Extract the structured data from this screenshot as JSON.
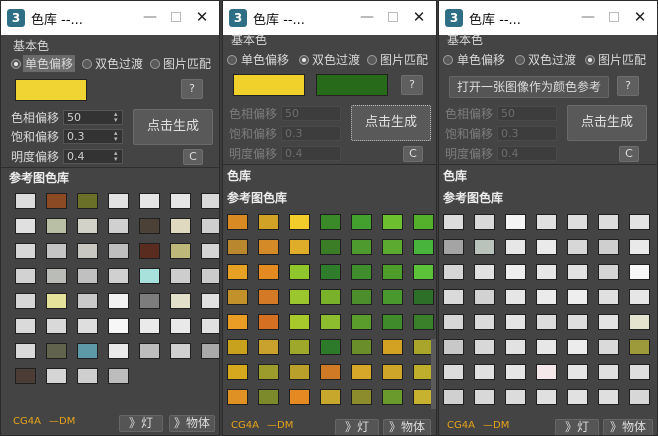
{
  "windows": [
    {
      "title": "色库 --...",
      "base_color_label": "基本色",
      "radios": [
        "单色偏移",
        "双色过渡",
        "图片匹配"
      ],
      "selected_radio": 0,
      "help_label": "?",
      "params": [
        {
          "label": "色相偏移",
          "value": "50"
        },
        {
          "label": "饱和偏移",
          "value": "0.3"
        },
        {
          "label": "明度偏移",
          "value": "0.4"
        }
      ],
      "params_enabled": true,
      "generate_label": "点击生成",
      "c_label": "C",
      "swatches": [
        "#f0d433"
      ],
      "ref_lib_label": "参考图色库",
      "footer": {
        "brand": "CG4A",
        "author": "—DM",
        "light_label": "》灯",
        "object_label": "》物体"
      },
      "ref_grid": [
        [
          "#dcdcdc",
          "#8c4a24",
          "#6b7028",
          "#e2e2e2",
          "#e4e4e4",
          "#e6e6e6",
          "#d9d9d9"
        ],
        [
          "#e0e0e0",
          "#b9bfa5",
          "#d2d2c8",
          "#d0d0d0",
          "#4b4136",
          "#ded9bf",
          "#cfcfcf"
        ],
        [
          "#d6d6d6",
          "#c4c4c4",
          "#c9c7c1",
          "#bfbfbf",
          "#5a2c20",
          "#bdb87a",
          "#d4d4d4"
        ],
        [
          "#d2d2d2",
          "#babcb8",
          "#c0c0c0",
          "#d0d0d0",
          "#a8e0dc",
          "#cdcdcd",
          "#cbcbcb"
        ],
        [
          "#d6d6d6",
          "#e5e29b",
          "#c8c8c8",
          "#f2f2f2",
          "#7d7d7d",
          "#e2e0c8",
          "#e0e0e0"
        ],
        [
          "#dadada",
          "#d9d9d9",
          "#dedede",
          "#f7f7f7",
          "#eaeaea",
          "#e9e9e9",
          "#e1e1e1"
        ],
        [
          "#d9d9d9",
          "#62634c",
          "#5d99a6",
          "#eaeaea",
          "#bdbdbd",
          "#cfcfcf",
          "#a9a9a9"
        ],
        [
          "#4b3c36",
          "#d5d5d5",
          "#cfcfcf",
          "#bdbdbd"
        ]
      ]
    },
    {
      "title": "色库 --...",
      "base_color_label": "基本色",
      "radios": [
        "单色偏移",
        "双色过渡",
        "图片匹配"
      ],
      "selected_radio": 1,
      "help_label": "?",
      "params": [
        {
          "label": "色相偏移",
          "value": "50"
        },
        {
          "label": "饱和偏移",
          "value": "0.3"
        },
        {
          "label": "明度偏移",
          "value": "0.4"
        }
      ],
      "params_enabled": false,
      "generate_label": "点击生成",
      "c_label": "C",
      "swatches": [
        "#f0d02a",
        "#276a1a"
      ],
      "color_lib_label": "色库",
      "ref_lib_label": "参考图色库",
      "footer": {
        "brand": "CG4A",
        "author": "—DM",
        "light_label": "》灯",
        "object_label": "》物体"
      },
      "color_grid": [
        [
          "#d98a22",
          "#d2a227",
          "#f1cc2a",
          "#3a8a2a",
          "#44a02e",
          "#6cbf2f",
          "#54b02a"
        ],
        [
          "#b8872e",
          "#d48a26",
          "#dfad2a",
          "#3b7c27",
          "#4e9a2e",
          "#5daa30",
          "#48b43c"
        ],
        [
          "#e6a024",
          "#e38a20",
          "#8fc62c",
          "#2f7d2c",
          "#3f8d2c",
          "#4e9d2b",
          "#5bc23a"
        ],
        [
          "#c2912a",
          "#d47a26",
          "#9cc62e",
          "#79b22a",
          "#4c8e2c",
          "#49982d",
          "#2d6f29"
        ],
        [
          "#e99d24",
          "#d56f22",
          "#a7c92c",
          "#8bbd2e",
          "#5a9d2d",
          "#3f8a2b",
          "#3a7f29"
        ]
      ],
      "ref_grid": [
        [
          "#c8a21c",
          "#c8a22c",
          "#9ea82a",
          "#2e7a2b",
          "#6a8f2a",
          "#d4a222",
          "#a9a42a"
        ],
        [
          "#d6a81e",
          "#9c9c2c",
          "#b9a02a",
          "#d07a25",
          "#d7a72a",
          "#cfa529",
          "#bfae2c"
        ],
        [
          "#e09123",
          "#7d8a2b",
          "#e58a22",
          "#c8a82c",
          "#8c8c2c",
          "#6a9a2c",
          "#c6b22e"
        ]
      ]
    },
    {
      "title": "色库 --...",
      "base_color_label": "基本色",
      "radios": [
        "单色偏移",
        "双色过渡",
        "图片匹配"
      ],
      "selected_radio": 2,
      "help_label": "?",
      "open_image_label": "打开一张图像作为颜色参考",
      "params": [
        {
          "label": "色相偏移",
          "value": "50"
        },
        {
          "label": "饱和偏移",
          "value": "0.3"
        },
        {
          "label": "明度偏移",
          "value": "0.4"
        }
      ],
      "params_enabled": false,
      "generate_label": "点击生成",
      "c_label": "C",
      "color_lib_label": "色库",
      "ref_lib_label": "参考图色库",
      "footer": {
        "brand": "CG4A",
        "author": "—DM",
        "light_label": "》灯",
        "object_label": "》物体"
      },
      "ref_grid": [
        [
          "#dcdcdc",
          "#d9d9d9",
          "#f4f4f4",
          "#e0e0e0",
          "#dedede",
          "#dcdcdc",
          "#e3e3e3"
        ],
        [
          "#a4a4a4",
          "#b9c2bb",
          "#e7e7e7",
          "#eaeaea",
          "#d7d7d7",
          "#cfcfcf",
          "#e9e9e9"
        ],
        [
          "#d5d5d5",
          "#e1e1e1",
          "#eeeeee",
          "#e7e7e7",
          "#e2e2e2",
          "#d3d3d3",
          "#f8f8f8"
        ],
        [
          "#dadada",
          "#d2d2d2",
          "#e6e6e6",
          "#ebebeb",
          "#eeeeee",
          "#e0e0e0",
          "#e6e6e6"
        ],
        [
          "#d6d6d6",
          "#dadada",
          "#e4e4e4",
          "#dcdcdc",
          "#dedede",
          "#e2e2e2",
          "#e3e3d0"
        ],
        [
          "#c8c8c8",
          "#d8d8d8",
          "#e2e2e2",
          "#e7e7e7",
          "#ececec",
          "#dadada",
          "#9c9a3a"
        ],
        [
          "#dbdbdb",
          "#e0e0e0",
          "#e5e5e5",
          "#f4e8ea",
          "#e5e5e5",
          "#e0e0e0",
          "#dedede"
        ],
        [
          "#d0d0d0",
          "#d8d8d8",
          "#dcdcdc",
          "#e0e0e0",
          "#e1e1e1",
          "#dfdfdf",
          "#d7d7d7"
        ]
      ]
    }
  ]
}
